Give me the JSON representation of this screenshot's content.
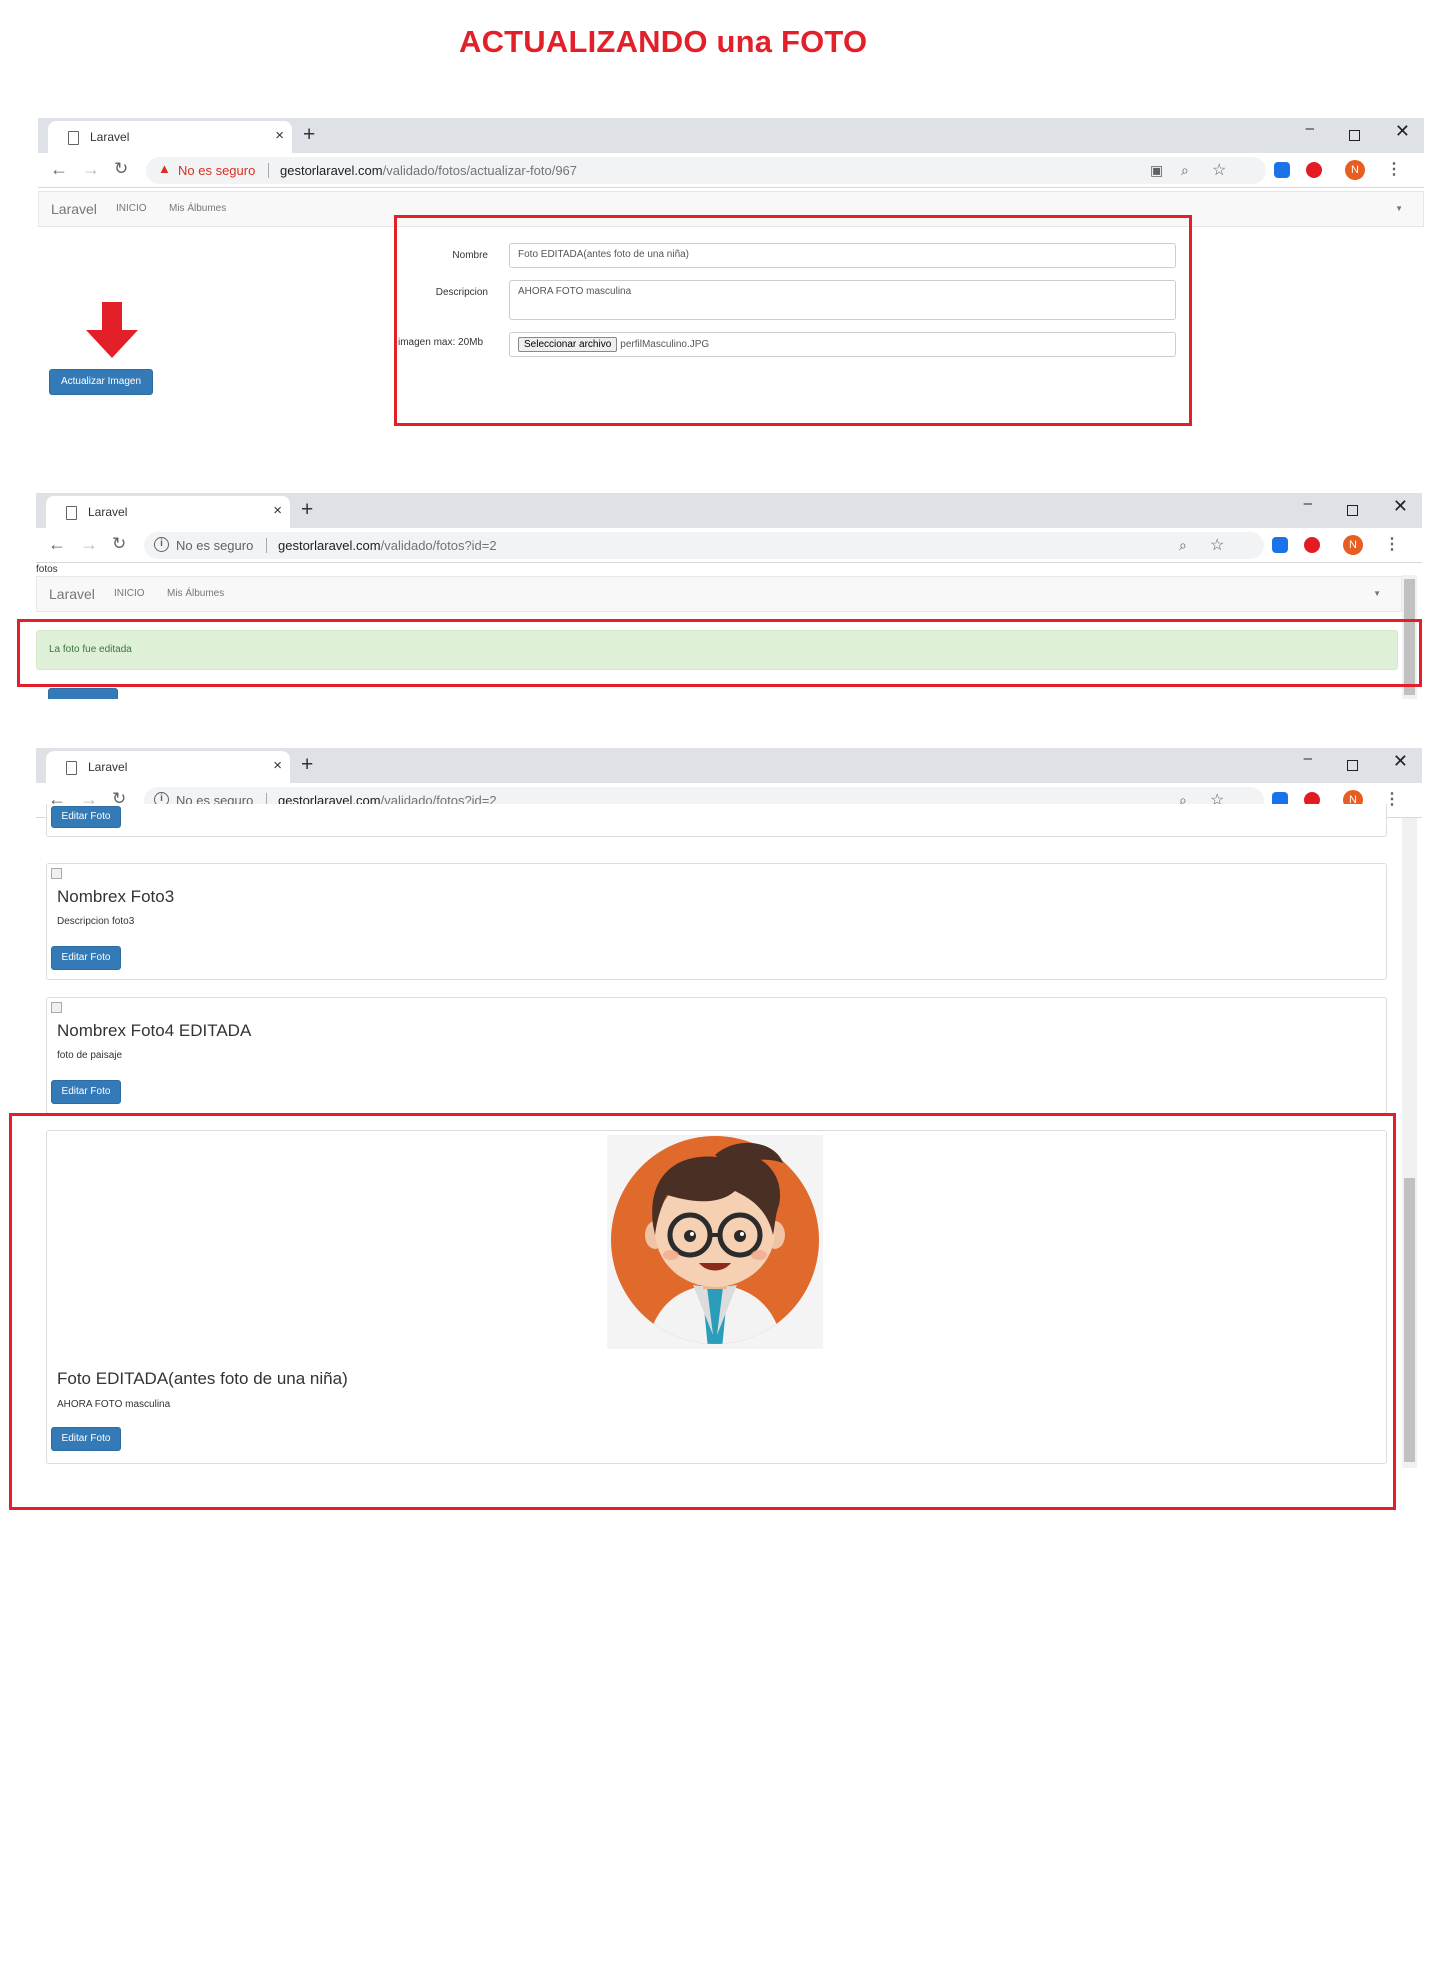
{
  "heading": "ACTUALIZANDO una FOTO",
  "browser": {
    "tab_title": "Laravel",
    "tab_close": "×",
    "new_tab": "+",
    "security": "No es seguro",
    "min": "–",
    "close": "✕",
    "profile_initial": "N",
    "icons": {
      "back": "arrow-left-icon",
      "forward": "arrow-right-icon",
      "reload": "reload-icon",
      "zoom": "magnifier-icon",
      "star": "star-icon",
      "translate": "translate-icon",
      "menu": "kebab-menu-icon"
    }
  },
  "shot1": {
    "url_host": "gestorlaravel.com",
    "url_path": "/validado/fotos/actualizar-foto/967",
    "app_brand": "Laravel",
    "nav_inicio": "INICIO",
    "nav_albumes": "Mis Álbumes",
    "form": {
      "nombre_label": "Nombre",
      "nombre_value": "Foto EDITADA(antes foto de una niña)",
      "descripcion_label": "Descripcion",
      "descripcion_value": "AHORA FOTO masculina",
      "imagen_label": "imagen max: 20Mb",
      "file_button": "Seleccionar archivo",
      "file_name": "perfilMasculino.JPG"
    },
    "submit_button": "Actualizar Imagen"
  },
  "shot2": {
    "url_host": "gestorlaravel.com",
    "url_path": "/validado/fotos?id=2",
    "page_label": "fotos",
    "app_brand": "Laravel",
    "nav_inicio": "INICIO",
    "nav_albumes": "Mis Álbumes",
    "alert": "La foto fue editada"
  },
  "shot3": {
    "url_host": "gestorlaravel.com",
    "url_path": "/validado/fotos?id=2",
    "edit_button": "Editar Foto",
    "cards": [
      {
        "title": "Nombrex Foto3",
        "description": "Descripcion foto3"
      },
      {
        "title": "Nombrex Foto4 EDITADA",
        "description": "foto de paisaje"
      },
      {
        "title": "Foto EDITADA(antes foto de una niña)",
        "description": "AHORA FOTO masculina"
      }
    ]
  },
  "colors": {
    "highlight_red": "#e3202a",
    "bootstrap_primary": "#337ab7",
    "success_bg": "#dff0d8",
    "avatar_orange": "#e0692c"
  }
}
